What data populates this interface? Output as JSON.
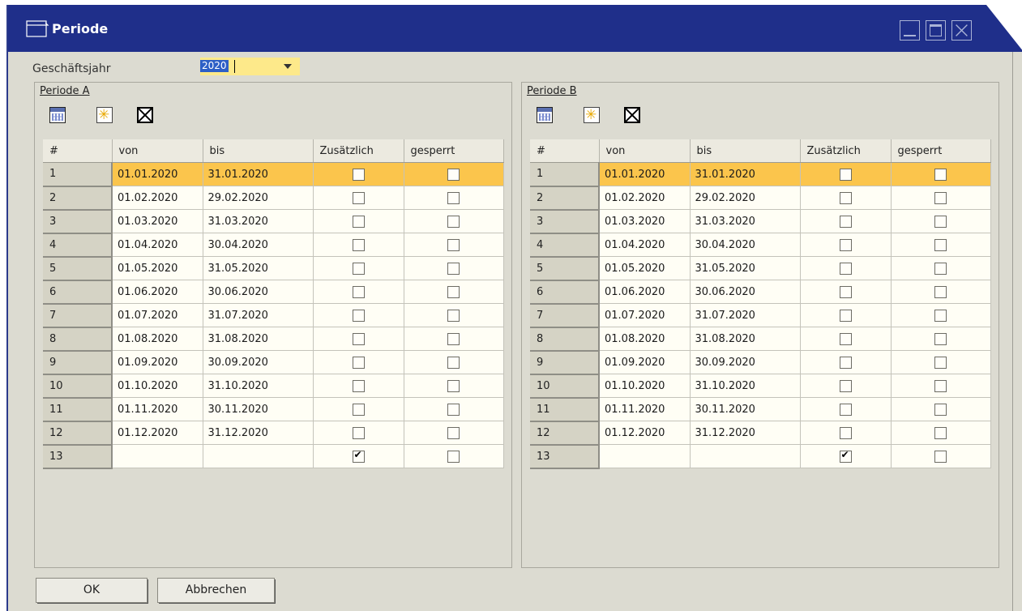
{
  "window": {
    "title": "Periode"
  },
  "fiscal_year": {
    "label": "Geschäftsjahr",
    "value": "2020"
  },
  "columns": [
    "#",
    "von",
    "bis",
    "Zusätzlich",
    "gesperrt"
  ],
  "panel_a": {
    "label": "Periode A",
    "rows": [
      {
        "n": "1",
        "von": "01.01.2020",
        "bis": "31.01.2020",
        "zus": false,
        "ges": false
      },
      {
        "n": "2",
        "von": "01.02.2020",
        "bis": "29.02.2020",
        "zus": false,
        "ges": false
      },
      {
        "n": "3",
        "von": "01.03.2020",
        "bis": "31.03.2020",
        "zus": false,
        "ges": false
      },
      {
        "n": "4",
        "von": "01.04.2020",
        "bis": "30.04.2020",
        "zus": false,
        "ges": false
      },
      {
        "n": "5",
        "von": "01.05.2020",
        "bis": "31.05.2020",
        "zus": false,
        "ges": false
      },
      {
        "n": "6",
        "von": "01.06.2020",
        "bis": "30.06.2020",
        "zus": false,
        "ges": false
      },
      {
        "n": "7",
        "von": "01.07.2020",
        "bis": "31.07.2020",
        "zus": false,
        "ges": false
      },
      {
        "n": "8",
        "von": "01.08.2020",
        "bis": "31.08.2020",
        "zus": false,
        "ges": false
      },
      {
        "n": "9",
        "von": "01.09.2020",
        "bis": "30.09.2020",
        "zus": false,
        "ges": false
      },
      {
        "n": "10",
        "von": "01.10.2020",
        "bis": "31.10.2020",
        "zus": false,
        "ges": false
      },
      {
        "n": "11",
        "von": "01.11.2020",
        "bis": "30.11.2020",
        "zus": false,
        "ges": false
      },
      {
        "n": "12",
        "von": "01.12.2020",
        "bis": "31.12.2020",
        "zus": false,
        "ges": false
      },
      {
        "n": "13",
        "von": "",
        "bis": "",
        "zus": true,
        "ges": false
      }
    ]
  },
  "panel_b": {
    "label": "Periode B",
    "rows": [
      {
        "n": "1",
        "von": "01.01.2020",
        "bis": "31.01.2020",
        "zus": false,
        "ges": false
      },
      {
        "n": "2",
        "von": "01.02.2020",
        "bis": "29.02.2020",
        "zus": false,
        "ges": false
      },
      {
        "n": "3",
        "von": "01.03.2020",
        "bis": "31.03.2020",
        "zus": false,
        "ges": false
      },
      {
        "n": "4",
        "von": "01.04.2020",
        "bis": "30.04.2020",
        "zus": false,
        "ges": false
      },
      {
        "n": "5",
        "von": "01.05.2020",
        "bis": "31.05.2020",
        "zus": false,
        "ges": false
      },
      {
        "n": "6",
        "von": "01.06.2020",
        "bis": "30.06.2020",
        "zus": false,
        "ges": false
      },
      {
        "n": "7",
        "von": "01.07.2020",
        "bis": "31.07.2020",
        "zus": false,
        "ges": false
      },
      {
        "n": "8",
        "von": "01.08.2020",
        "bis": "31.08.2020",
        "zus": false,
        "ges": false
      },
      {
        "n": "9",
        "von": "01.09.2020",
        "bis": "30.09.2020",
        "zus": false,
        "ges": false
      },
      {
        "n": "10",
        "von": "01.10.2020",
        "bis": "31.10.2020",
        "zus": false,
        "ges": false
      },
      {
        "n": "11",
        "von": "01.11.2020",
        "bis": "30.11.2020",
        "zus": false,
        "ges": false
      },
      {
        "n": "12",
        "von": "01.12.2020",
        "bis": "31.12.2020",
        "zus": false,
        "ges": false
      },
      {
        "n": "13",
        "von": "",
        "bis": "",
        "zus": true,
        "ges": false
      }
    ]
  },
  "buttons": {
    "ok": "OK",
    "cancel": "Abbrechen"
  },
  "icons": [
    "form-icon",
    "minimize-icon",
    "maximize-icon",
    "close-icon",
    "calendar-icon",
    "new-row-icon",
    "delete-row-icon",
    "dropdown-arrow-icon"
  ],
  "colors": {
    "titlebar": "#1f2f8a",
    "selected_row": "#fbc54c",
    "field_bg": "#fde98a",
    "window_bg": "#dcdbd1"
  }
}
